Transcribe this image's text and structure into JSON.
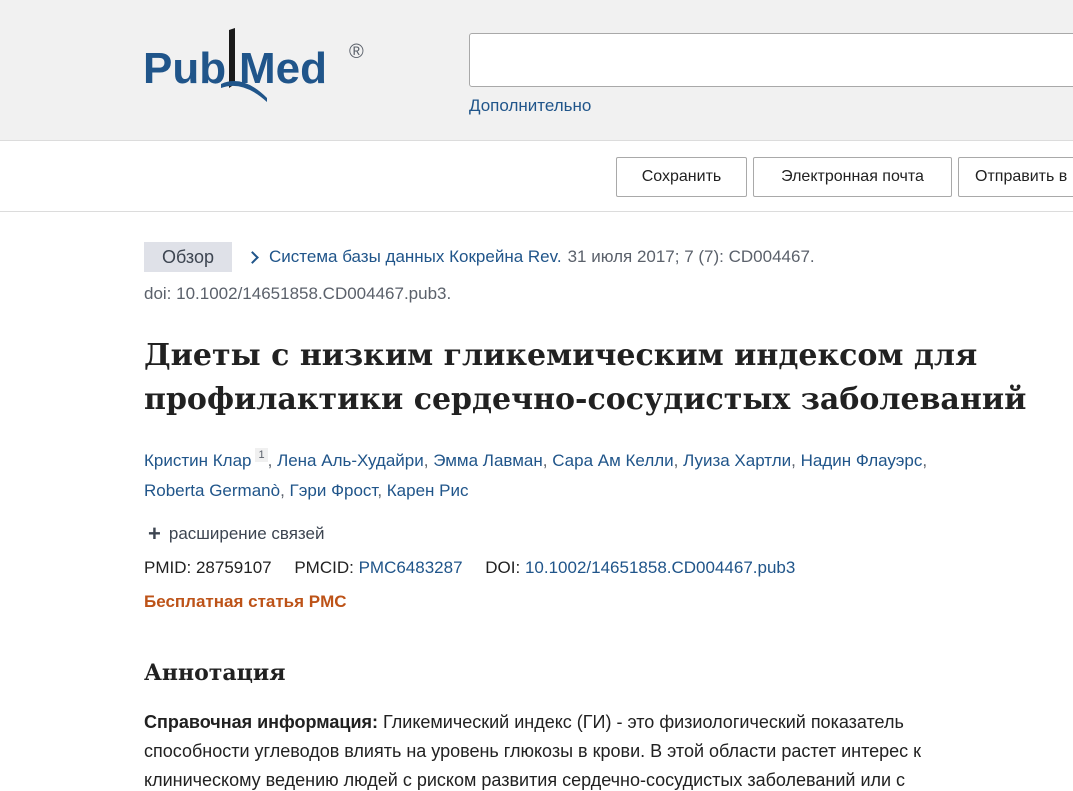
{
  "header": {
    "logo": {
      "brand_left": "Pub",
      "brand_right": "Med",
      "registered": "®"
    },
    "search": {
      "value": "",
      "placeholder": ""
    },
    "advanced_label": "Дополнительно"
  },
  "toolbar": {
    "save_label": "Сохранить",
    "email_label": "Электронная почта",
    "send_label": "Отправить в"
  },
  "article": {
    "badge": "Обзор",
    "journal": "Система базы данных Кокрейна Rev.",
    "citation": "31 июля 2017; 7 (7): CD004467.",
    "doi_line": "doi: 10.1002/14651858.CD004467.pub3.",
    "title": "Диеты с низким гликемическим индексом для профилактики сердечно-сосудистых заболеваний",
    "authors": [
      {
        "name": "Кристин Клар",
        "aff": "1"
      },
      {
        "name": "Лена Аль-Худайри"
      },
      {
        "name": "Эмма Лавман"
      },
      {
        "name": "Сара Ам Келли"
      },
      {
        "name": "Луиза Хартли"
      },
      {
        "name": "Надин Флауэрс"
      },
      {
        "name": "Roberta Germanò"
      },
      {
        "name": "Гэри Фрост"
      },
      {
        "name": "Карен Рис"
      }
    ],
    "expand_label": "расширение связей",
    "pmid_label": "PMID:",
    "pmid": "28759107",
    "pmcid_label": "PMCID:",
    "pmcid": "PMC6483287",
    "doi_label": "DOI:",
    "doi": "10.1002/14651858.CD004467.pub3",
    "free_pmc": "Бесплатная статья PMC"
  },
  "abstract": {
    "heading": "Аннотация",
    "background_label": "Справочная информация:",
    "background_text": "Гликемический индекс (ГИ) - это физиологический показатель способности углеводов влиять на уровень глюкозы в крови. В этой области растет интерес к клиническому ведению людей с риском развития сердечно-сосудистых заболеваний или с"
  },
  "colors": {
    "link": "#20558a",
    "free_pmc": "#bd5318",
    "header_bg": "#f1f1f1",
    "badge_bg": "#dfe1e8"
  }
}
